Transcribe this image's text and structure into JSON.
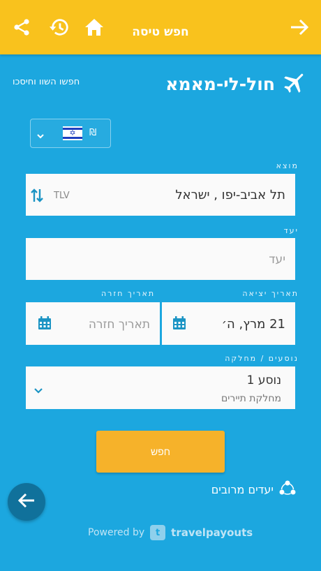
{
  "topbar": {
    "title": "חפש טיסה"
  },
  "brand": {
    "name": "חול-לי-מאמא",
    "slogan": "חפשו השוו וחיסכו"
  },
  "currency": {
    "symbol": "₪",
    "flag_symbol": "✡"
  },
  "origin": {
    "label": "מוצא",
    "value": "תל אביב-יפו , ישראל",
    "code": "TLV"
  },
  "destination": {
    "label": "יעד",
    "placeholder": "יעד"
  },
  "departure": {
    "label": "תאריך יציאה",
    "value": "21 מרץ, ה׳"
  },
  "return": {
    "label": "תאריך חזרה",
    "placeholder": "תאריך חזרה"
  },
  "passengers": {
    "label": "נוסעים / מחלקה",
    "value": "נוסע 1",
    "class": "מחלקת תיירים"
  },
  "search_button": "חפש",
  "popular": "יעדים מרובים",
  "powered": {
    "label": "Powered by",
    "logo_letter": "t",
    "name": "travelpayouts"
  },
  "colors": {
    "background": "#1ca7df",
    "topbar": "#f9c21d",
    "button": "#f6b22a",
    "fab": "#10719b",
    "icon_teal": "#1b94c4"
  }
}
